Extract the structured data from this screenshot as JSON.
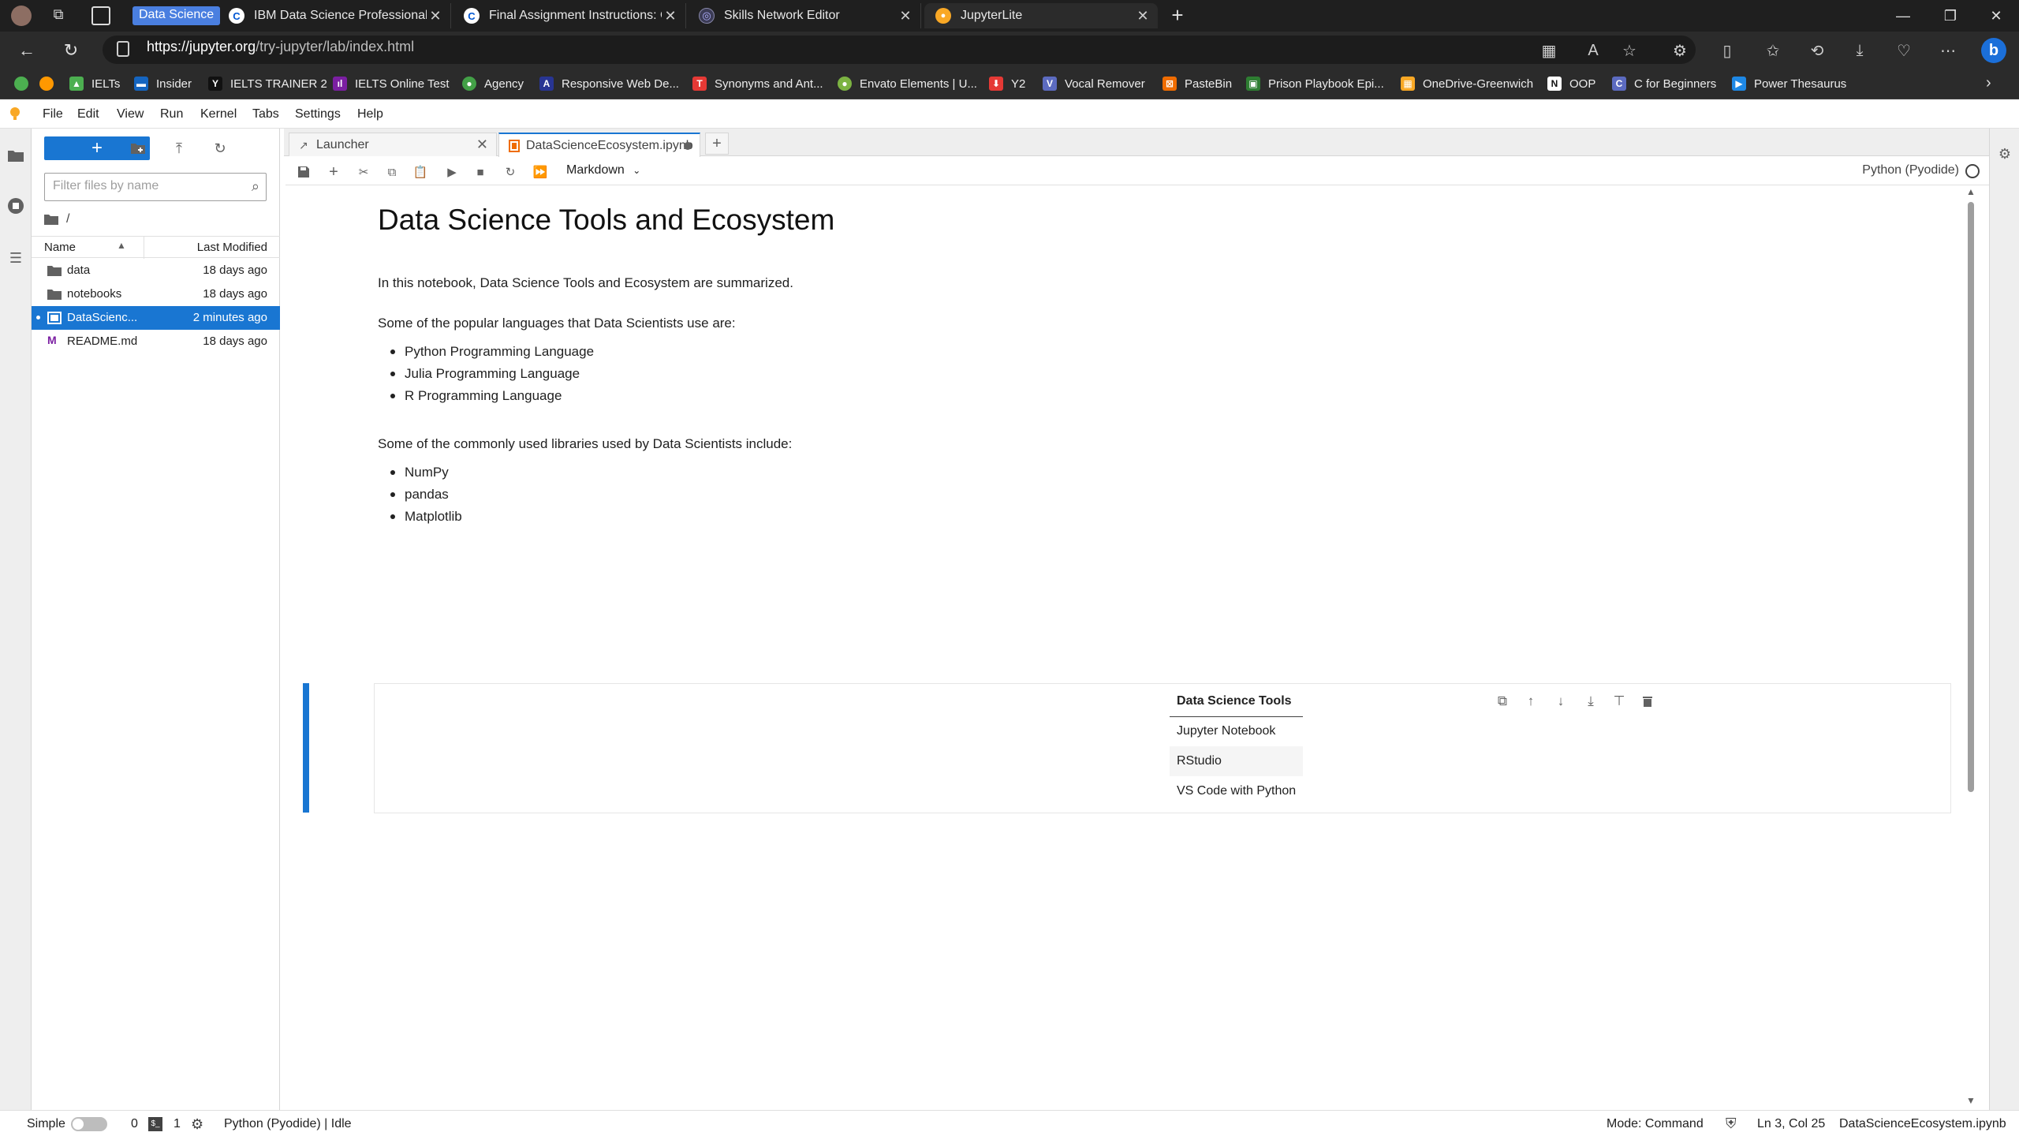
{
  "browser": {
    "tab_group_label": "Data Science",
    "tabs": [
      {
        "label": "IBM Data Science Professional Ce",
        "icon": "coursera-icon"
      },
      {
        "label": "Final Assignment Instructions: Cr",
        "icon": "coursera-icon"
      },
      {
        "label": "Skills Network Editor",
        "icon": "skills-network-icon"
      },
      {
        "label": "JupyterLite",
        "icon": "jupyter-icon"
      }
    ],
    "url_host": "https://jupyter.org",
    "url_path": "/try-jupyter/lab/index.html",
    "bookmarks": [
      {
        "label": "IELTs",
        "color": "#4caf50"
      },
      {
        "label": "Insider",
        "color": "#1565c0"
      },
      {
        "label": "IELTS TRAINER 2",
        "color": "#000000"
      },
      {
        "label": "IELTS Online Test",
        "color": "#7b1fa2"
      },
      {
        "label": "Agency",
        "color": "#43a047"
      },
      {
        "label": "Responsive Web De...",
        "color": "#283593"
      },
      {
        "label": "Synonyms and Ant...",
        "color": "#e53935"
      },
      {
        "label": "Envato Elements | U...",
        "color": "#7cb342"
      },
      {
        "label": "Y2",
        "color": "#e53935"
      },
      {
        "label": "Vocal Remover",
        "color": "#5c6bc0"
      },
      {
        "label": "PasteBin",
        "color": "#ef6c00"
      },
      {
        "label": "Prison Playbook Epi...",
        "color": "#2e7d32"
      },
      {
        "label": "OneDrive-Greenwich",
        "color": "#f9a825"
      },
      {
        "label": "OOP",
        "color": "#212121"
      },
      {
        "label": "C for Beginners",
        "color": "#5c6bc0"
      },
      {
        "label": "Power Thesaurus",
        "color": "#1e88e5"
      }
    ]
  },
  "menubar": [
    "File",
    "Edit",
    "View",
    "Run",
    "Kernel",
    "Tabs",
    "Settings",
    "Help"
  ],
  "filebrowser": {
    "new_label": "+",
    "filter_placeholder": "Filter files by name",
    "breadcrumb": "/",
    "col_name": "Name",
    "col_modified": "Last Modified",
    "files": [
      {
        "name": "data",
        "modified": "18 days ago",
        "type": "folder"
      },
      {
        "name": "notebooks",
        "modified": "18 days ago",
        "type": "folder"
      },
      {
        "name": "DataScienc...",
        "modified": "2 minutes ago",
        "type": "notebook"
      },
      {
        "name": "README.md",
        "modified": "18 days ago",
        "type": "markdown"
      }
    ]
  },
  "dock_tabs": [
    {
      "label": "Launcher"
    },
    {
      "label": "DataScienceEcosystem.ipynb"
    }
  ],
  "notebook_toolbar": {
    "cell_type": "Markdown",
    "kernel": "Python (Pyodide)"
  },
  "notebook": {
    "title": "Data Science Tools and Ecosystem",
    "intro": "In this notebook, Data Science Tools and Ecosystem are summarized.",
    "languages_intro": "Some of the popular languages that Data Scientists use are:",
    "languages": [
      "Python Programming Language",
      "Julia Programming Language",
      "R Programming Language"
    ],
    "libraries_intro": "Some of the commonly used libraries used by Data Scientists include:",
    "libraries": [
      "NumPy",
      "pandas",
      "Matplotlib"
    ],
    "table": {
      "header": "Data Science Tools",
      "rows": [
        "Jupyter Notebook",
        "RStudio",
        "VS Code with Python"
      ]
    }
  },
  "statusbar": {
    "simple": "Simple",
    "terminals": "0",
    "kernels": "1",
    "kernel_status": "Python (Pyodide) | Idle",
    "mode": "Mode: Command",
    "position": "Ln 3, Col 25",
    "filename": "DataScienceEcosystem.ipynb"
  }
}
